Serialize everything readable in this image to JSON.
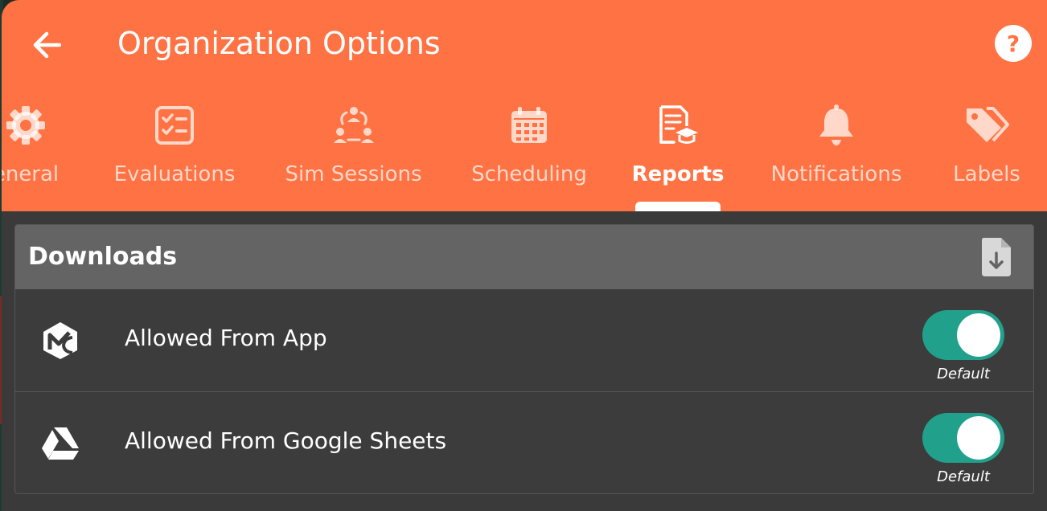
{
  "header": {
    "title": "Organization Options",
    "back_icon": "arrow-left-icon",
    "help_label": "?",
    "background_color": "#ff7243"
  },
  "tabs": [
    {
      "label": "eneral",
      "icon": "gear-icon",
      "active": false
    },
    {
      "label": "Evaluations",
      "icon": "checklist-icon",
      "active": false
    },
    {
      "label": "Sim Sessions",
      "icon": "team-icon",
      "active": false
    },
    {
      "label": "Scheduling",
      "icon": "calendar-icon",
      "active": false
    },
    {
      "label": "Reports",
      "icon": "report-graduation-icon",
      "active": true
    },
    {
      "label": "Notifications",
      "icon": "bell-icon",
      "active": false
    },
    {
      "label": "Labels",
      "icon": "tags-icon",
      "active": false
    }
  ],
  "downloads": {
    "title": "Downloads",
    "header_icon": "file-download-icon",
    "rows": [
      {
        "label": "Allowed From App",
        "icon": "app-logo-icon",
        "toggle_on": true,
        "status": "Default"
      },
      {
        "label": "Allowed From Google Sheets",
        "icon": "google-drive-icon",
        "toggle_on": true,
        "status": "Default"
      }
    ],
    "toggle_color": "#21a08c"
  }
}
